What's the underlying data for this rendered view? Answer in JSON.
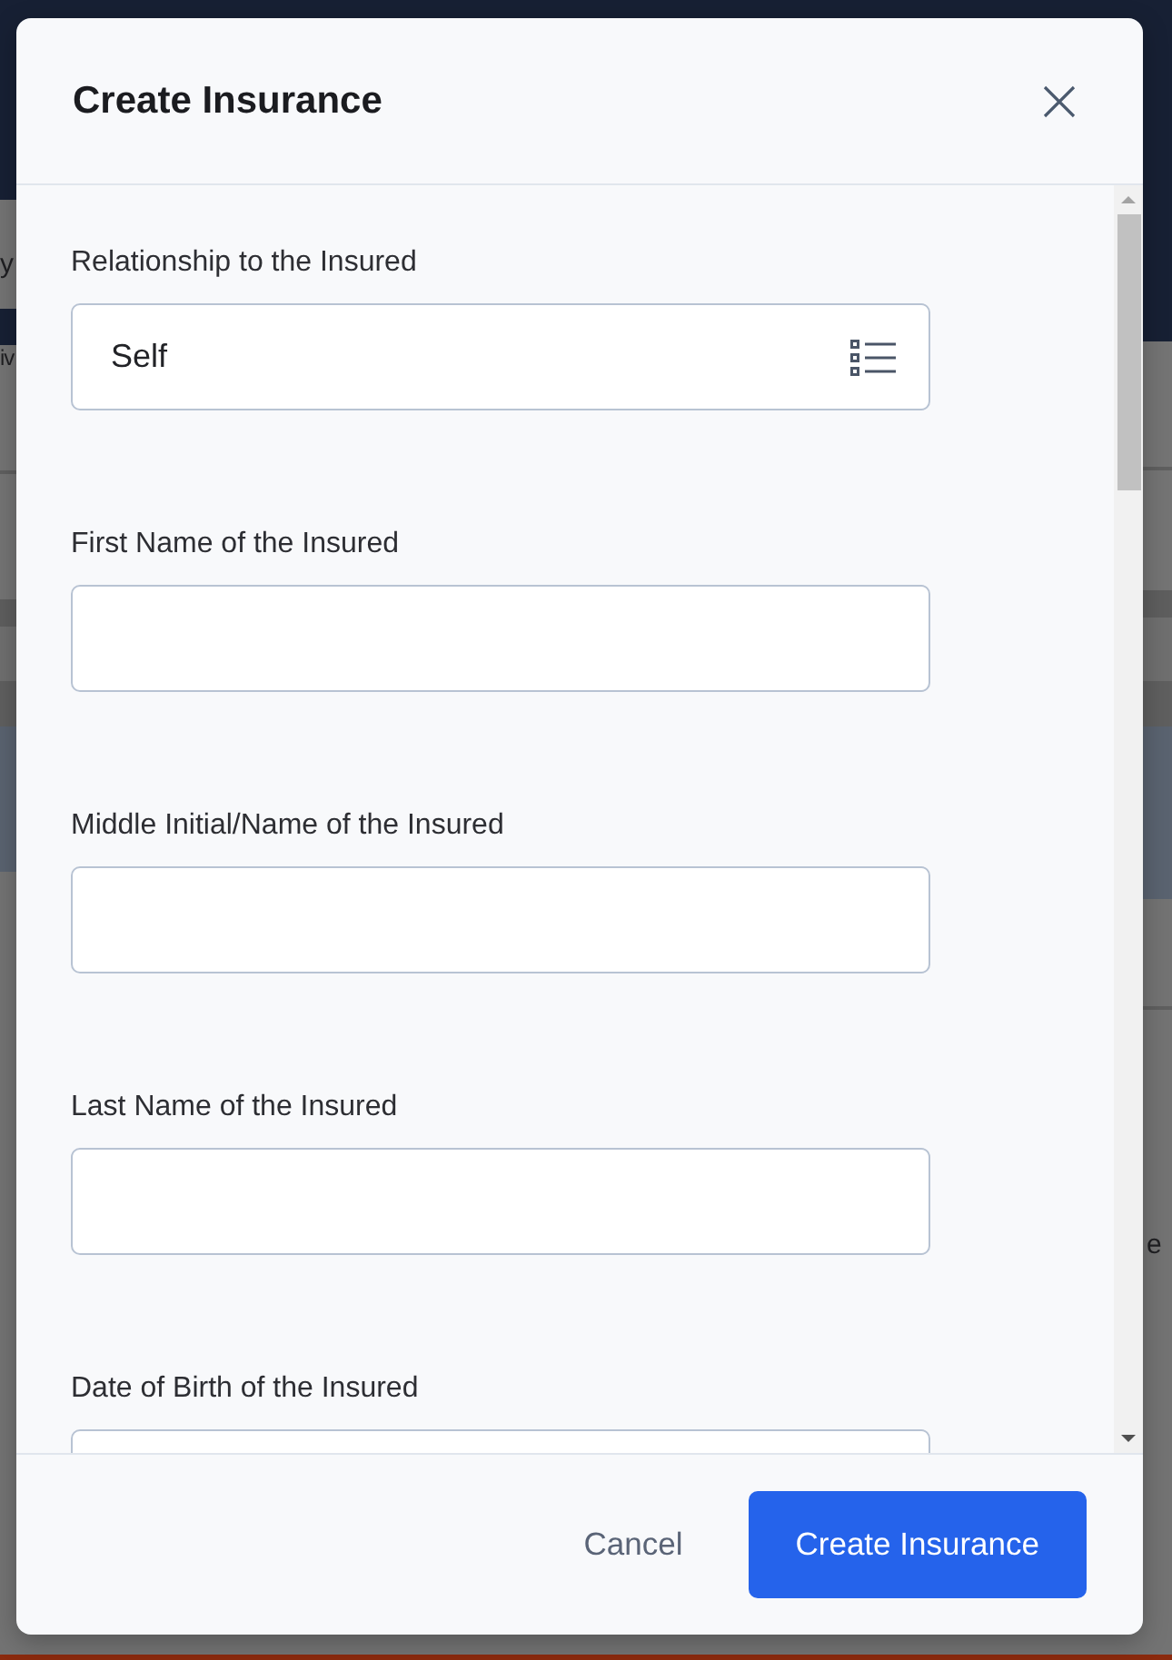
{
  "backdrop": {
    "left_texts": [
      "y",
      "iv"
    ],
    "right_texts": [
      "e"
    ]
  },
  "dialog": {
    "title": "Create Insurance",
    "fields": [
      {
        "label": "Relationship to the Insured",
        "kind": "select",
        "value": "Self"
      },
      {
        "label": "First Name of the Insured",
        "kind": "text"
      },
      {
        "label": "Middle Initial/Name of the Insured",
        "kind": "text"
      },
      {
        "label": "Last Name of the Insured",
        "kind": "text"
      },
      {
        "label": "Date of Birth of the Insured",
        "kind": "text"
      }
    ],
    "buttons": [
      {
        "label": "Cancel",
        "kind": "secondary"
      },
      {
        "label": "Create Insurance",
        "kind": "primary"
      }
    ]
  }
}
